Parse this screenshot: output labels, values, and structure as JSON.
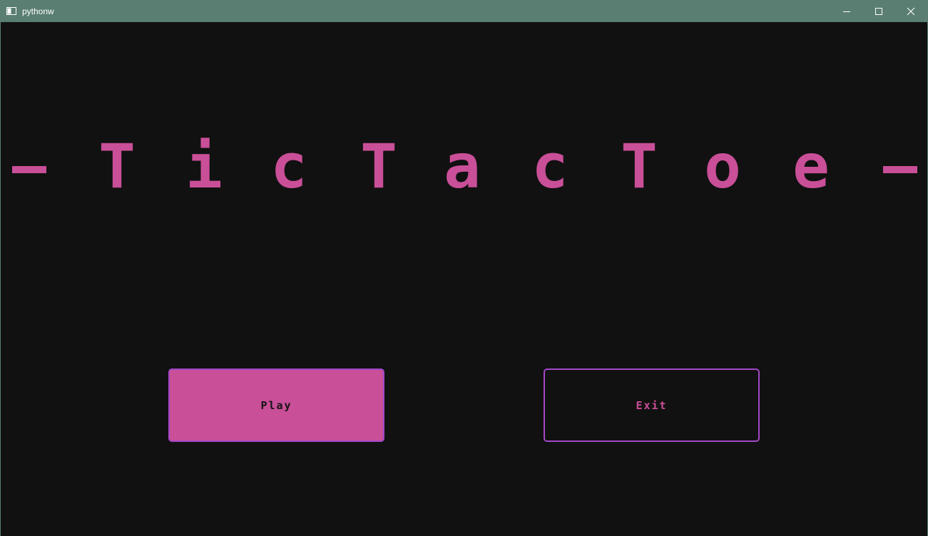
{
  "window": {
    "title": "pythonw",
    "controls": [
      "minimize-icon",
      "maximize-icon",
      "close-icon"
    ]
  },
  "game": {
    "title_text": "- T i c T a c T o e -",
    "title_letters": [
      "T",
      "i",
      "c",
      "T",
      "a",
      "c",
      "T",
      "o",
      "e"
    ],
    "play_label": "Play",
    "exit_label": "Exit"
  },
  "colors": {
    "titlebar": "#5a7e72",
    "background": "#111111",
    "accent_pink": "#c94f98",
    "button_border": "#a347c8"
  }
}
